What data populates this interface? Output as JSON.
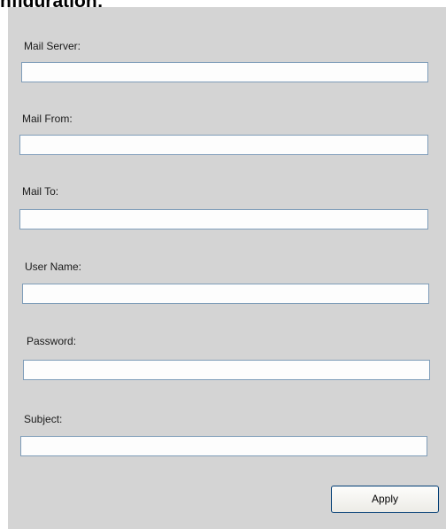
{
  "header": {
    "title_fragment": "nfiguration:"
  },
  "form": {
    "fields": [
      {
        "label": "Mail Server:",
        "value": ""
      },
      {
        "label": "Mail From:",
        "value": ""
      },
      {
        "label": "Mail To:",
        "value": ""
      },
      {
        "label": "User Name:",
        "value": ""
      },
      {
        "label": "Password:",
        "value": ""
      },
      {
        "label": "Subject:",
        "value": ""
      }
    ],
    "apply_label": "Apply"
  }
}
